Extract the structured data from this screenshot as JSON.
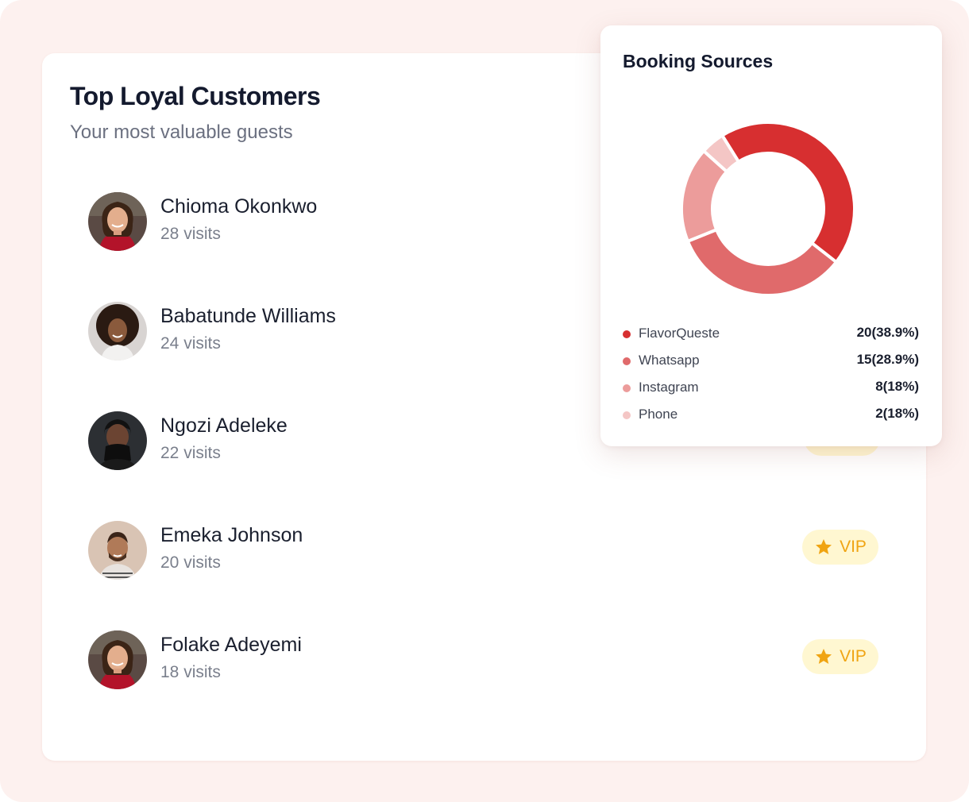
{
  "loyal_customers": {
    "title": "Top Loyal Customers",
    "subtitle": "Your most valuable guests",
    "customers": [
      {
        "name": "Chioma Okonkwo",
        "visits": "28 visits"
      },
      {
        "name": "Babatunde Williams",
        "visits": "24 visits"
      },
      {
        "name": "Ngozi Adeleke",
        "visits": "22 visits"
      },
      {
        "name": "Emeka Johnson",
        "visits": "20 visits",
        "badge": "VIP"
      },
      {
        "name": "Folake Adeyemi",
        "visits": "18 visits",
        "badge": "VIP"
      }
    ],
    "badge_icon": "star-icon",
    "badge_color": "#f0a412"
  },
  "booking_sources": {
    "title": "Booking Sources",
    "items": [
      {
        "label": "FlavorQueste",
        "value": "20(38.9%)",
        "color": "#d72f30"
      },
      {
        "label": "Whatsapp",
        "value": "15(28.9%)",
        "color": "#e06a6b"
      },
      {
        "label": "Instagram",
        "value": "8(18%)",
        "color": "#ec9c9b"
      },
      {
        "label": "Phone",
        "value": "2(18%)",
        "color": "#f4c6c5"
      }
    ]
  },
  "chart_data": {
    "type": "pie",
    "categories": [
      "FlavorQueste",
      "Whatsapp",
      "Instagram",
      "Phone"
    ],
    "values": [
      20,
      15,
      8,
      2
    ],
    "colors": [
      "#d72f30",
      "#e06a6b",
      "#ec9c9b",
      "#f4c6c5"
    ],
    "title": "Booking Sources",
    "donut": true
  }
}
